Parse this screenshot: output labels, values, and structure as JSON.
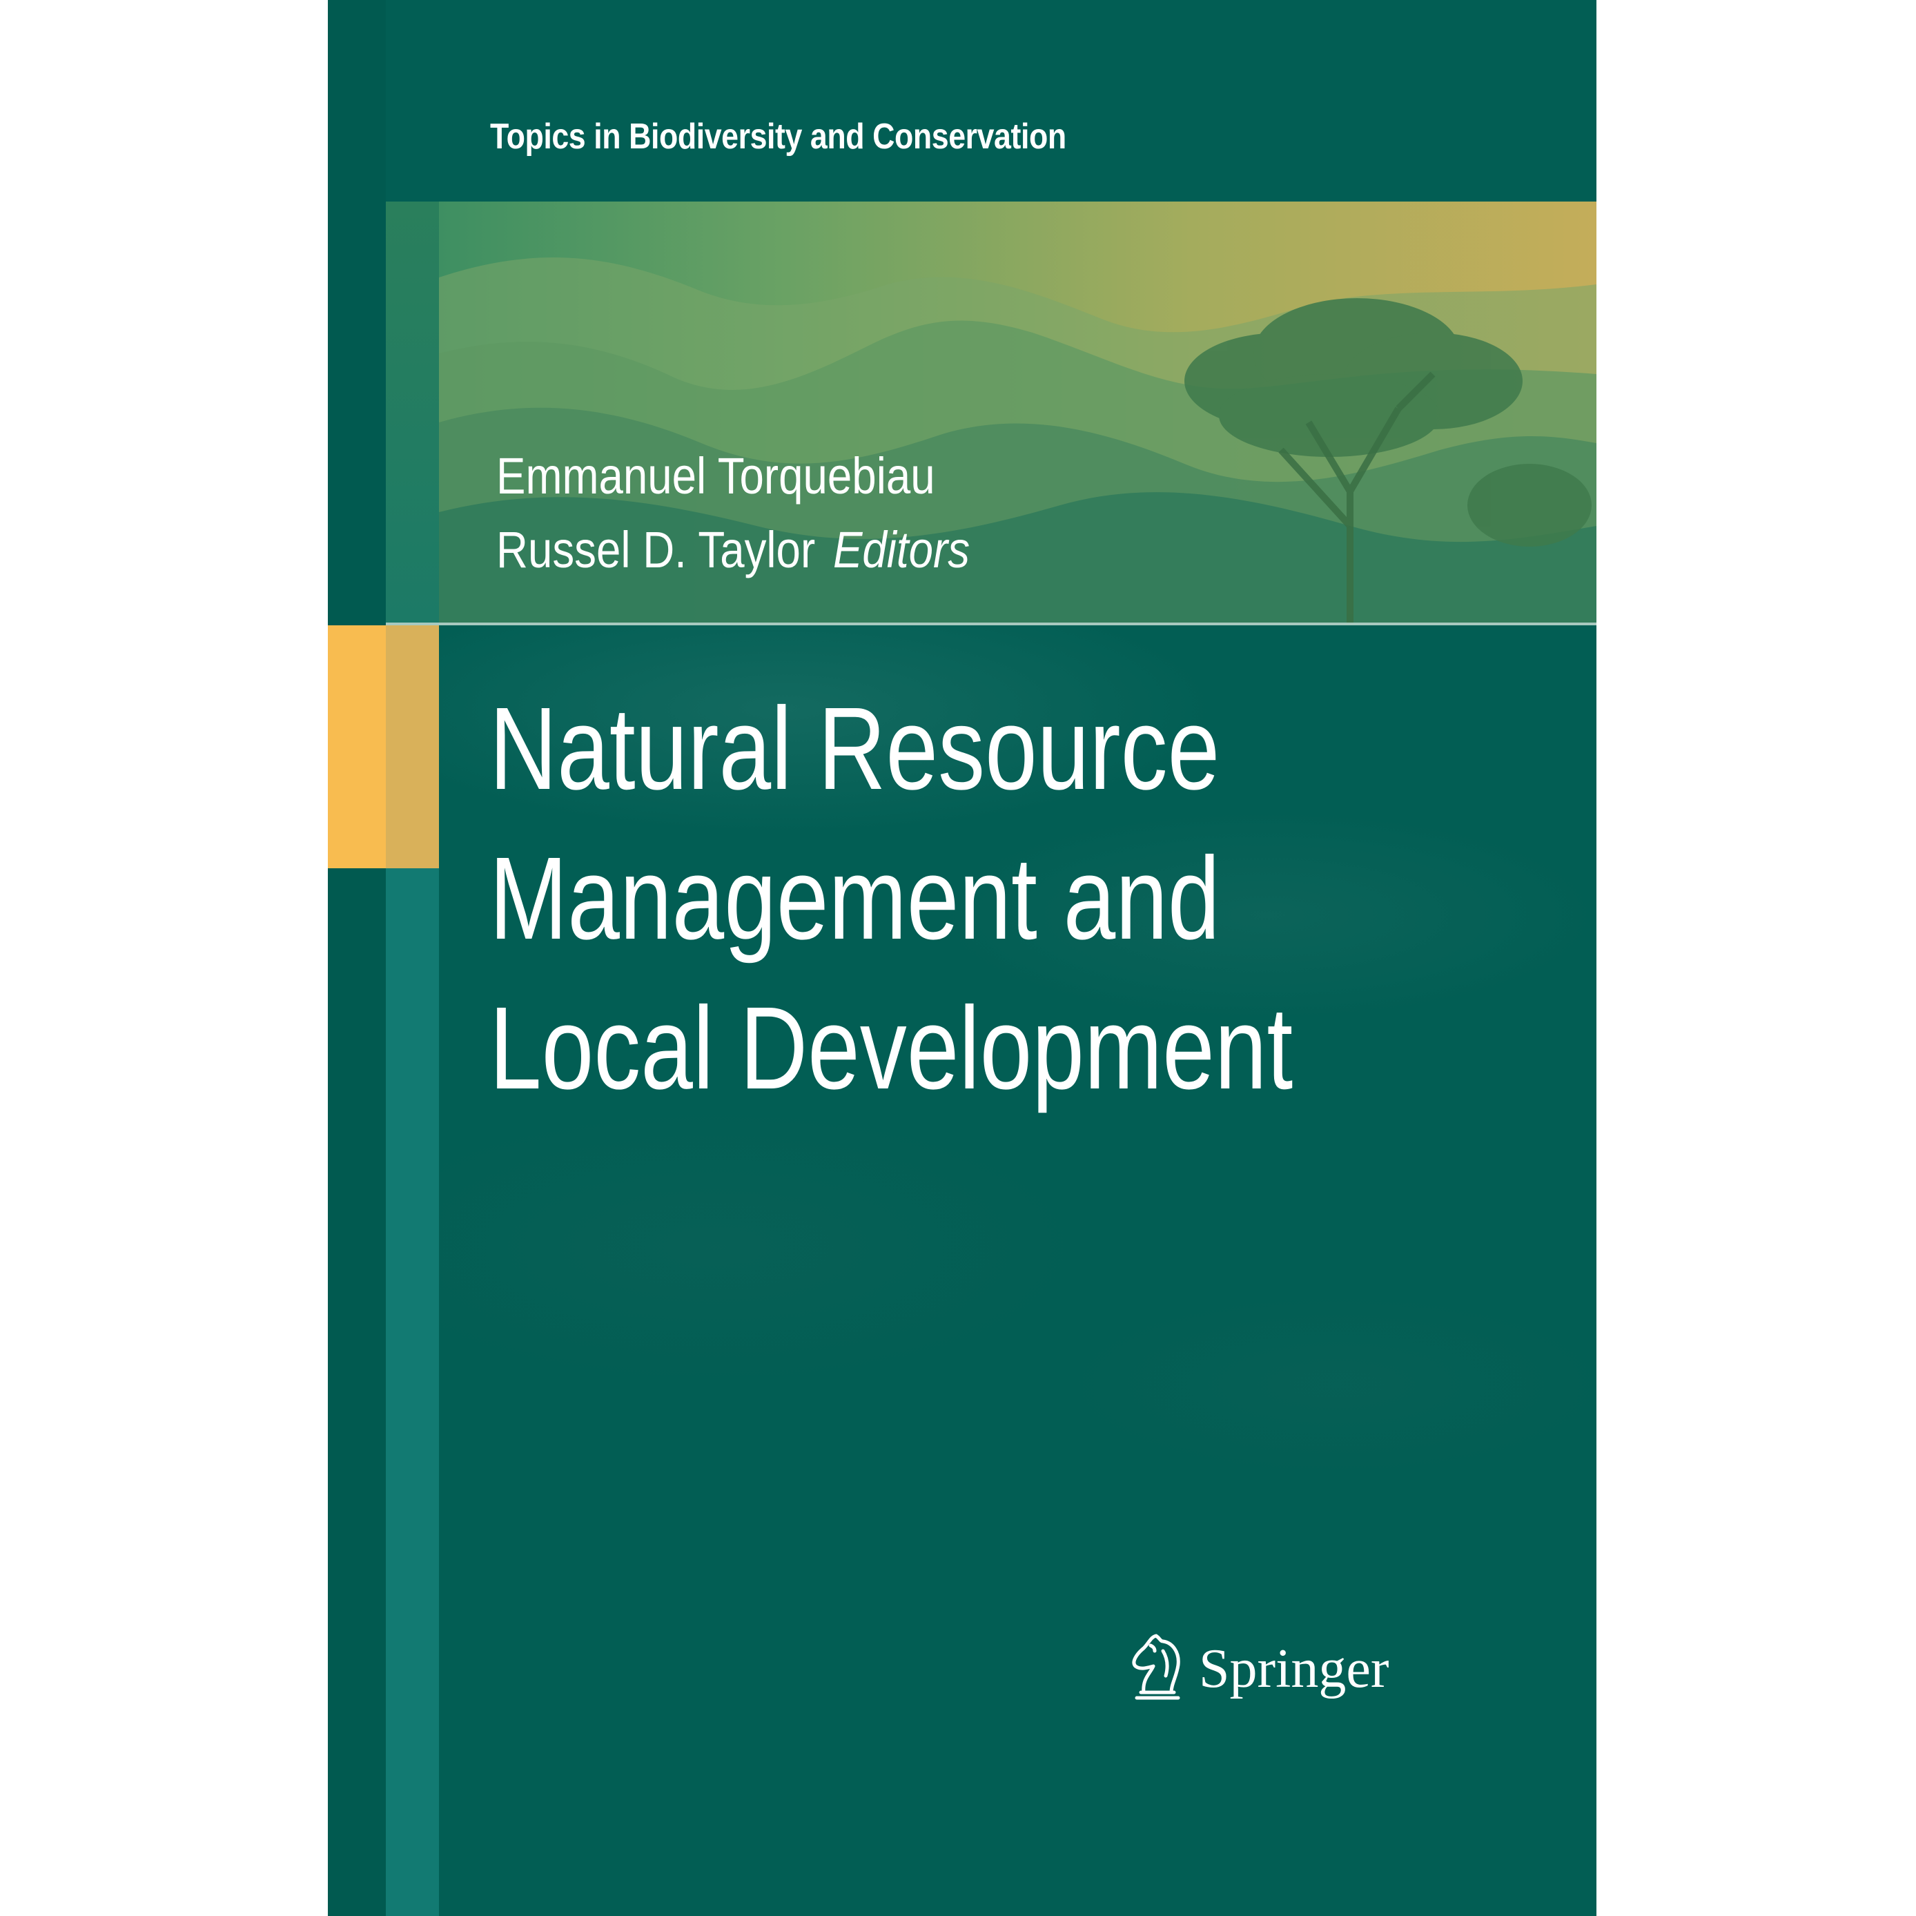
{
  "cover": {
    "series": "Topics in Biodiversity and Conservation",
    "editors": [
      {
        "name": "Emmanuel Torquebiau"
      },
      {
        "name": "Russel D. Taylor"
      }
    ],
    "editors_label": "Editors",
    "title_lines": [
      "Natural Resource",
      "Management and",
      "Local Development"
    ],
    "publisher": "Springer",
    "publisher_logo_icon": "chess-knight-icon"
  },
  "colors": {
    "background": "#025e54",
    "strip": "#127a72",
    "accent_orange": "#f8bc50",
    "accent_gold": "#d9b15a",
    "text": "#ffffff"
  }
}
